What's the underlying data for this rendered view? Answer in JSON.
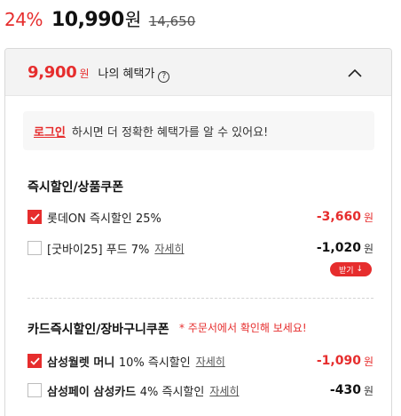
{
  "price": {
    "discount": "24%",
    "sale_price": "10,990",
    "sale_unit": "원",
    "original_price": "14,650"
  },
  "benefit_panel": {
    "price": "9,900",
    "unit": "원",
    "label": "나의 혜택가",
    "help_icon": "?"
  },
  "login_notice": {
    "link": "로그인",
    "message": "하시면 더 정확한 혜택가를 알 수 있어요!"
  },
  "section_instant": {
    "title": "즉시할인/상품쿠폰",
    "items": [
      {
        "label": "롯데ON 즉시할인 25%",
        "amount": "-3,660",
        "unit": "원",
        "checked": true
      },
      {
        "label": "[굿바이25] 푸드 7%",
        "detail": "자세히",
        "amount": "-1,020",
        "unit": "원",
        "checked": false,
        "button": "받기",
        "button_icon": "↓"
      }
    ]
  },
  "section_card": {
    "title": "카드즉시할인/장바구니쿠폰",
    "note": "* 주문서에서 확인해 보세요!",
    "items": [
      {
        "label_bold": "삼성월렛 머니",
        "label_rest": "10% 즉시할인",
        "detail": "자세히",
        "amount": "-1,090",
        "unit": "원",
        "checked": true
      },
      {
        "label_bold": "삼성페이 삼성카드",
        "label_rest": "4% 즉시할인",
        "detail": "자세히",
        "amount": "-430",
        "unit": "원",
        "checked": false
      }
    ]
  },
  "colors": {
    "accent": "#e62d2d",
    "panel_header": "#f3f3f3"
  }
}
